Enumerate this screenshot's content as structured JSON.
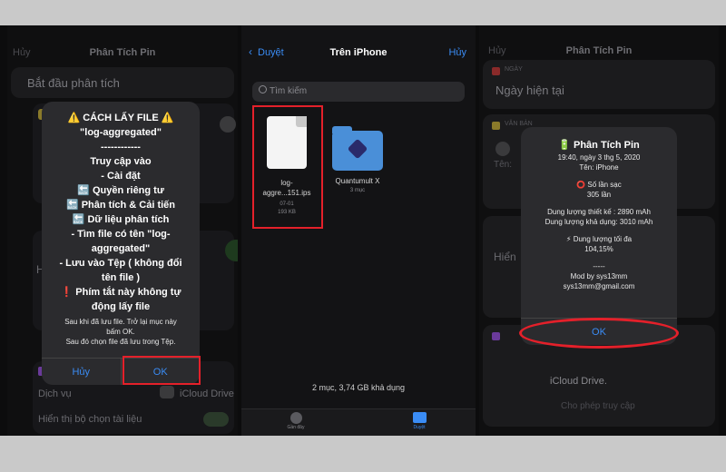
{
  "colors": {
    "accent": "#3a8cf5",
    "highlight": "#e4202a"
  },
  "left": {
    "nav": {
      "cancel": "Hủy",
      "title": "Phân Tích Pin"
    },
    "start_label": "Bắt đầu phân tích",
    "alert": {
      "title_line": "⚠️ CÁCH LẤY FILE ⚠️",
      "lines": [
        "\"log-aggregated\"",
        "------------",
        "Truy cập vào",
        "- Cài đặt",
        "🔙 Quyền riêng tư",
        "🔙 Phân tích & Cải tiến",
        "🔙 Dữ liệu phân tích",
        "- Tìm file có tên \"log-",
        "aggregated\"",
        "- Lưu vào Tệp ( không đổi",
        "tên file )",
        "❗ Phím tắt này không tự",
        "động lấy file"
      ],
      "note_lines": [
        "Sau khi đã lưu file. Trở lại mục này",
        "bấm OK.",
        "Sau đó chọn file đã lưu trong Tệp."
      ],
      "cancel_label": "Hủy",
      "ok_label": "OK"
    },
    "bg": {
      "hien_label": "Hiển",
      "service_label": "Dịch vụ",
      "service_value": "iCloud Drive",
      "bottom_label": "Hiển thị bộ chọn tài liệu"
    }
  },
  "middle": {
    "nav": {
      "back": "Duyệt",
      "title": "Trên iPhone",
      "cancel": "Hủy"
    },
    "search_placeholder": "Tìm kiếm",
    "files": [
      {
        "name_lines": [
          "log-",
          "aggre...151.ips"
        ],
        "meta_lines": [
          "07-01",
          "193 KB"
        ]
      },
      {
        "name_lines": [
          "Quantumult X"
        ],
        "meta_lines": [
          "3 mục"
        ]
      }
    ],
    "footer_status": "2 mục, 3,74 GB khả dụng",
    "tabs": {
      "recent": "Gần đây",
      "browse": "Duyệt"
    }
  },
  "right": {
    "nav": {
      "cancel": "Hủy",
      "title": "Phân Tích Pin"
    },
    "bg": {
      "date_tag": "NGÀY",
      "date_value": "Ngày hiện tại",
      "text_tag": "VĂN BẢN",
      "ten_label": "Tên:",
      "hien_label": "Hiển",
      "icloud_line1": "iCloud Drive.",
      "allow_access": "Cho phép truy cập"
    },
    "alert": {
      "title": "🔋 Phân Tích Pin",
      "lines": [
        "19:40, ngày 3 thg 5, 2020",
        "Tên: iPhone",
        "",
        "⭕ Số lần sạc",
        "305 lần",
        "",
        "Dung lượng thiết kế : 2890 mAh",
        "Dung lượng khả dụng: 3010 mAh",
        "",
        "⚡ Dung lượng tối đa",
        "104,15%",
        "",
        "-----",
        "Mod by sys13mm",
        "sys13mm@gmail.com"
      ],
      "ok_label": "OK"
    }
  }
}
